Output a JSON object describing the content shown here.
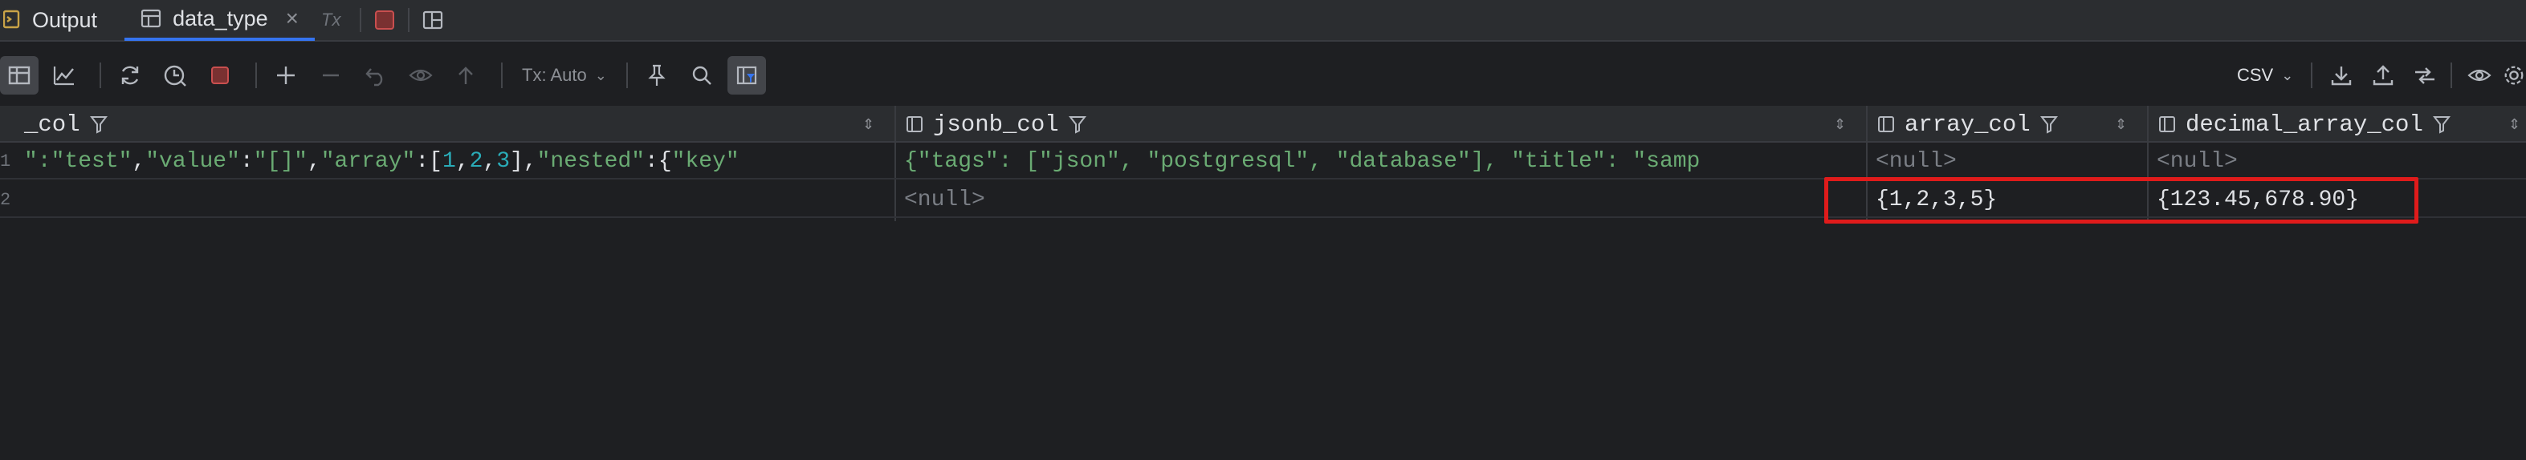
{
  "tabs": [
    {
      "label": "Output",
      "icon": "output-console-icon",
      "active": false
    },
    {
      "label": "data_type",
      "icon": "table-icon",
      "active": true
    }
  ],
  "tab_extra": {
    "tx_label": "Tx"
  },
  "toolbar": {
    "tx_mode": "Tx: Auto",
    "export_format": "CSV"
  },
  "columns": [
    {
      "name": "_col"
    },
    {
      "name": "jsonb_col"
    },
    {
      "name": "array_col"
    },
    {
      "name": "decimal_array_col"
    }
  ],
  "rows": [
    {
      "num": "1",
      "json_col_parts": [
        {
          "t": "\":",
          "c": "str"
        },
        {
          "t": "\"test\"",
          "c": "str"
        },
        {
          "t": ",",
          "c": "plain"
        },
        {
          "t": "\"value\"",
          "c": "str"
        },
        {
          "t": ":",
          "c": "plain"
        },
        {
          "t": "\"[]\"",
          "c": "str"
        },
        {
          "t": ",",
          "c": "plain"
        },
        {
          "t": "\"array\"",
          "c": "str"
        },
        {
          "t": ":[",
          "c": "plain"
        },
        {
          "t": "1",
          "c": "num"
        },
        {
          "t": ",",
          "c": "plain"
        },
        {
          "t": "2",
          "c": "num"
        },
        {
          "t": ",",
          "c": "plain"
        },
        {
          "t": "3",
          "c": "num"
        },
        {
          "t": "],",
          "c": "plain"
        },
        {
          "t": "\"nested\"",
          "c": "str"
        },
        {
          "t": ":{",
          "c": "plain"
        },
        {
          "t": "\"key\"",
          "c": "str"
        }
      ],
      "jsonb_col": "{\"tags\": [\"json\", \"postgresql\", \"database\"], \"title\": \"samp",
      "array_col": "<null>",
      "decimal_array_col": "<null>"
    },
    {
      "num": "2",
      "json_col_parts": [],
      "jsonb_col": "<null>",
      "array_col": "{1,2,3,5}",
      "decimal_array_col": "{123.45,678.90}"
    }
  ],
  "colors": {
    "highlight_box": "#e01b1b",
    "accent": "#3574f0",
    "string": "#6aab73",
    "number": "#2aacb8"
  }
}
